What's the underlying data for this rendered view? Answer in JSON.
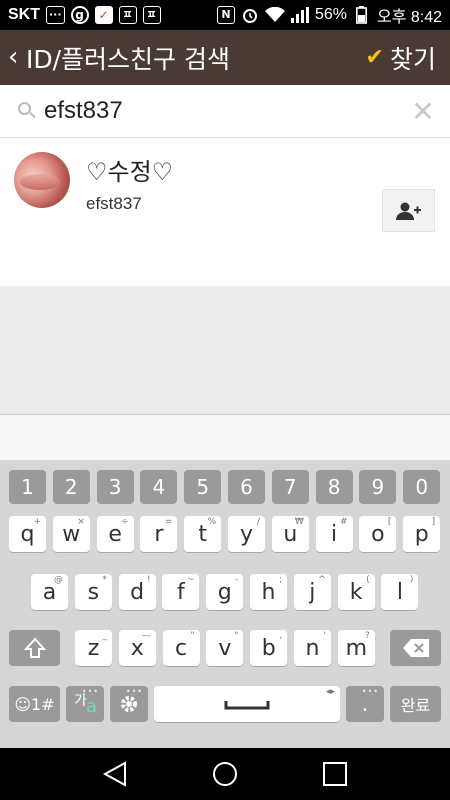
{
  "status_bar": {
    "carrier": "SKT",
    "battery": "56%",
    "time": "오후 8:42",
    "icons": [
      "chat-icon",
      "g-icon",
      "calendar-icon",
      "app-icon",
      "app-icon",
      "nfc-icon",
      "alarm-icon",
      "wifi-icon",
      "signal-icon",
      "battery-icon"
    ]
  },
  "header": {
    "title": "ID/플러스친구 검색",
    "find_label": "찾기",
    "accent": "#f4c60f",
    "background": "#4a3a35"
  },
  "search": {
    "value": "efst837"
  },
  "result": {
    "name": "♡수정♡",
    "id": "efst837"
  },
  "keyboard": {
    "numbers": [
      "1",
      "2",
      "3",
      "4",
      "5",
      "6",
      "7",
      "8",
      "9",
      "0"
    ],
    "row1": [
      {
        "k": "q",
        "h": "+"
      },
      {
        "k": "w",
        "h": "×"
      },
      {
        "k": "e",
        "h": "÷"
      },
      {
        "k": "r",
        "h": "="
      },
      {
        "k": "t",
        "h": "%"
      },
      {
        "k": "y",
        "h": "/"
      },
      {
        "k": "u",
        "h": "₩"
      },
      {
        "k": "i",
        "h": "#"
      },
      {
        "k": "o",
        "h": "["
      },
      {
        "k": "p",
        "h": "]"
      }
    ],
    "row2": [
      {
        "k": "a",
        "h": "@"
      },
      {
        "k": "s",
        "h": "*"
      },
      {
        "k": "d",
        "h": "!"
      },
      {
        "k": "f",
        "h": "~"
      },
      {
        "k": "g",
        "h": "-"
      },
      {
        "k": "h",
        "h": ";"
      },
      {
        "k": "j",
        "h": "^"
      },
      {
        "k": "k",
        "h": "("
      },
      {
        "k": "l",
        "h": ")"
      }
    ],
    "row3": [
      {
        "k": "z",
        "h": "_"
      },
      {
        "k": "x",
        "h": "—"
      },
      {
        "k": "c",
        "h": "\""
      },
      {
        "k": "v",
        "h": "\""
      },
      {
        "k": "b",
        "h": ","
      },
      {
        "k": "n",
        "h": "'"
      },
      {
        "k": "m",
        "h": "?"
      }
    ],
    "sym_label": "☺1#",
    "lang_label": "가",
    "lang_sub": "a",
    "period": ".",
    "done_label": "완료"
  }
}
